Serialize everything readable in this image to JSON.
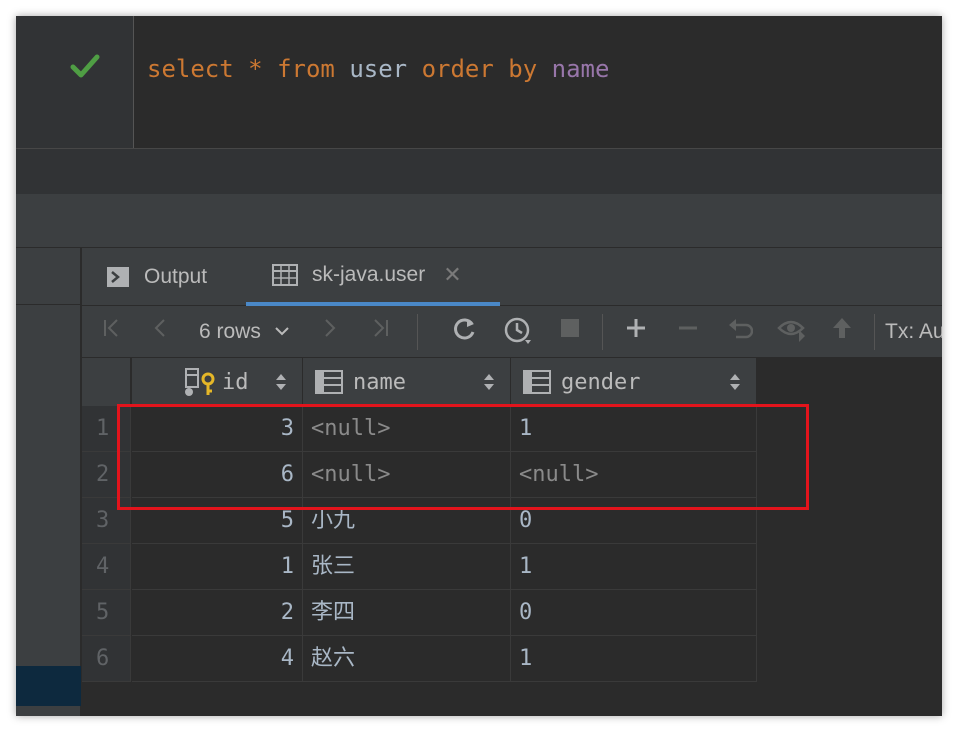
{
  "editor": {
    "status_icon": "check-icon",
    "tokens": [
      {
        "text": "select",
        "kind": "kw"
      },
      {
        "text": " ",
        "kind": "id"
      },
      {
        "text": "*",
        "kind": "op"
      },
      {
        "text": " ",
        "kind": "id"
      },
      {
        "text": "from",
        "kind": "kw"
      },
      {
        "text": " ",
        "kind": "id"
      },
      {
        "text": "user",
        "kind": "id"
      },
      {
        "text": " ",
        "kind": "id"
      },
      {
        "text": "order",
        "kind": "kw"
      },
      {
        "text": " ",
        "kind": "id"
      },
      {
        "text": "by",
        "kind": "kw"
      },
      {
        "text": " ",
        "kind": "id"
      },
      {
        "text": "name",
        "kind": "col"
      }
    ]
  },
  "tabs": {
    "output_label": "Output",
    "result_label": "sk-java.user",
    "close_glyph": "✕"
  },
  "toolbar": {
    "first": "|<",
    "prev": "<",
    "rows_label": "6 rows",
    "next": ">",
    "last": ">|",
    "tx_label": "Tx: Au"
  },
  "grid": {
    "columns": [
      "id",
      "name",
      "gender"
    ],
    "rows": [
      {
        "num": "1",
        "id": "3",
        "name": "<null>",
        "gender": "1"
      },
      {
        "num": "2",
        "id": "6",
        "name": "<null>",
        "gender": "<null>"
      },
      {
        "num": "3",
        "id": "5",
        "name": "小九",
        "gender": "0"
      },
      {
        "num": "4",
        "id": "1",
        "name": "张三",
        "gender": "1"
      },
      {
        "num": "5",
        "id": "2",
        "name": "李四",
        "gender": "0"
      },
      {
        "num": "6",
        "id": "4",
        "name": "赵六",
        "gender": "1"
      }
    ]
  },
  "colors": {
    "keyword": "#cc7832",
    "column": "#9876aa",
    "highlight": "#e3141c",
    "check": "#4f9e44"
  }
}
